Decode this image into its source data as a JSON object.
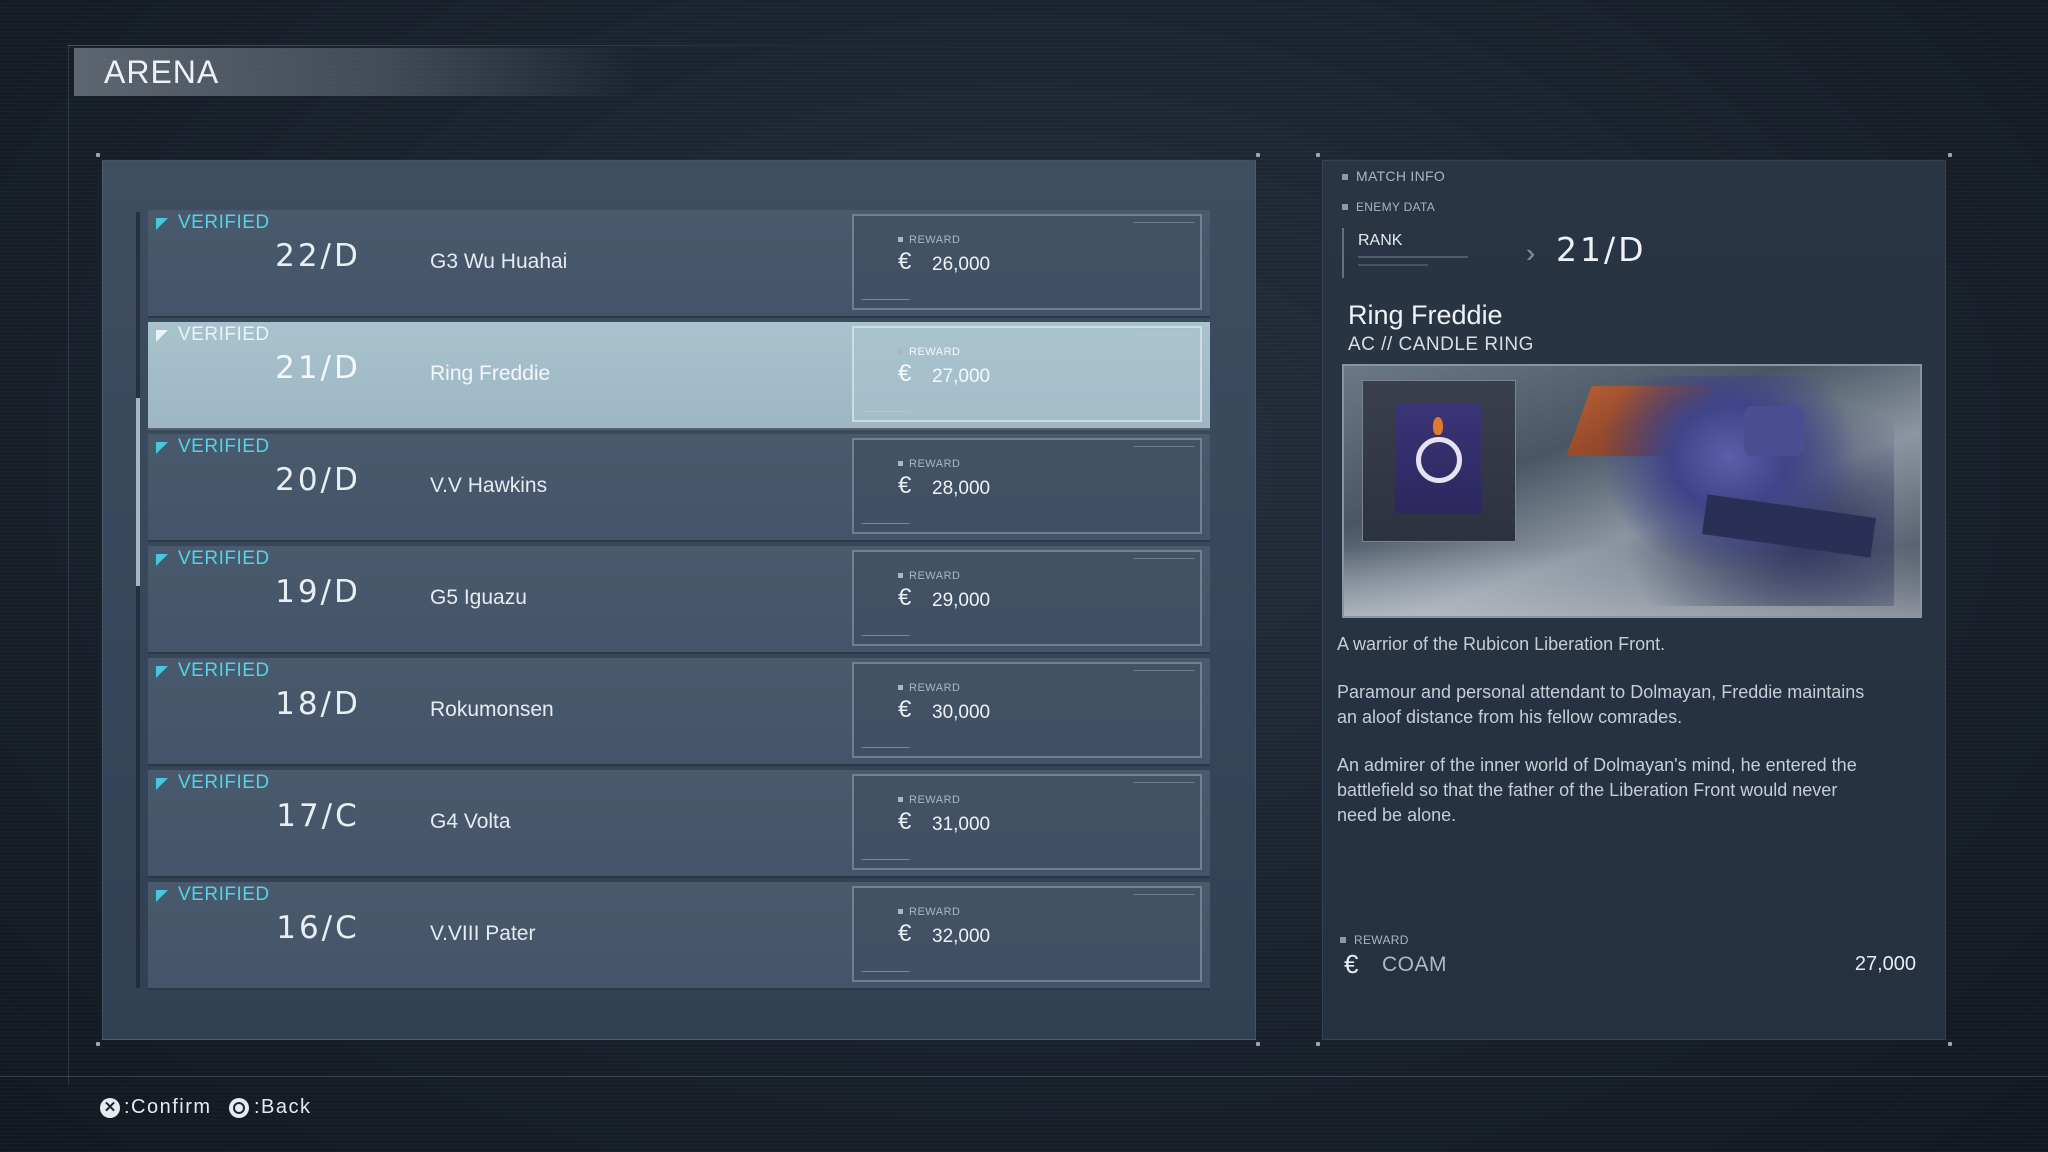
{
  "screen_title": "ARENA",
  "opponents": [
    {
      "status": "VERIFIED",
      "rank": "22/D",
      "name": "G3 Wu Huahai",
      "reward_label": "REWARD",
      "currency": "€",
      "reward": "26,000",
      "selected": false
    },
    {
      "status": "VERIFIED",
      "rank": "21/D",
      "name": "Ring Freddie",
      "reward_label": "REWARD",
      "currency": "€",
      "reward": "27,000",
      "selected": true
    },
    {
      "status": "VERIFIED",
      "rank": "20/D",
      "name": "V.V Hawkins",
      "reward_label": "REWARD",
      "currency": "€",
      "reward": "28,000",
      "selected": false
    },
    {
      "status": "VERIFIED",
      "rank": "19/D",
      "name": "G5 Iguazu",
      "reward_label": "REWARD",
      "currency": "€",
      "reward": "29,000",
      "selected": false
    },
    {
      "status": "VERIFIED",
      "rank": "18/D",
      "name": "Rokumonsen",
      "reward_label": "REWARD",
      "currency": "€",
      "reward": "30,000",
      "selected": false
    },
    {
      "status": "VERIFIED",
      "rank": "17/C",
      "name": "G4 Volta",
      "reward_label": "REWARD",
      "currency": "€",
      "reward": "31,000",
      "selected": false
    },
    {
      "status": "VERIFIED",
      "rank": "16/C",
      "name": "V.VIII Pater",
      "reward_label": "REWARD",
      "currency": "€",
      "reward": "32,000",
      "selected": false
    }
  ],
  "match_info": {
    "section_label": "MATCH INFO",
    "enemy_data_label": "ENEMY DATA",
    "rank_label": "RANK",
    "rank_value": "21/D",
    "enemy_name": "Ring Freddie",
    "enemy_ac": "AC // CANDLE RING",
    "description": [
      "A warrior of the Rubicon Liberation Front.",
      "Paramour and personal attendant to Dolmayan, Freddie maintains an aloof distance from his fellow comrades.",
      "An admirer of the inner world of Dolmayan's mind, he entered the battlefield so that the father of the Liberation Front would never need be alone."
    ],
    "reward_label": "REWARD",
    "currency": "€",
    "currency_name": "COAM",
    "reward_value": "27,000"
  },
  "footer": {
    "confirm_icon": "✕",
    "confirm_label": ":Confirm",
    "back_label": ":Back"
  },
  "colors": {
    "accent_cyan": "#4fd4ea",
    "selected_row": "#a8c2ce"
  }
}
